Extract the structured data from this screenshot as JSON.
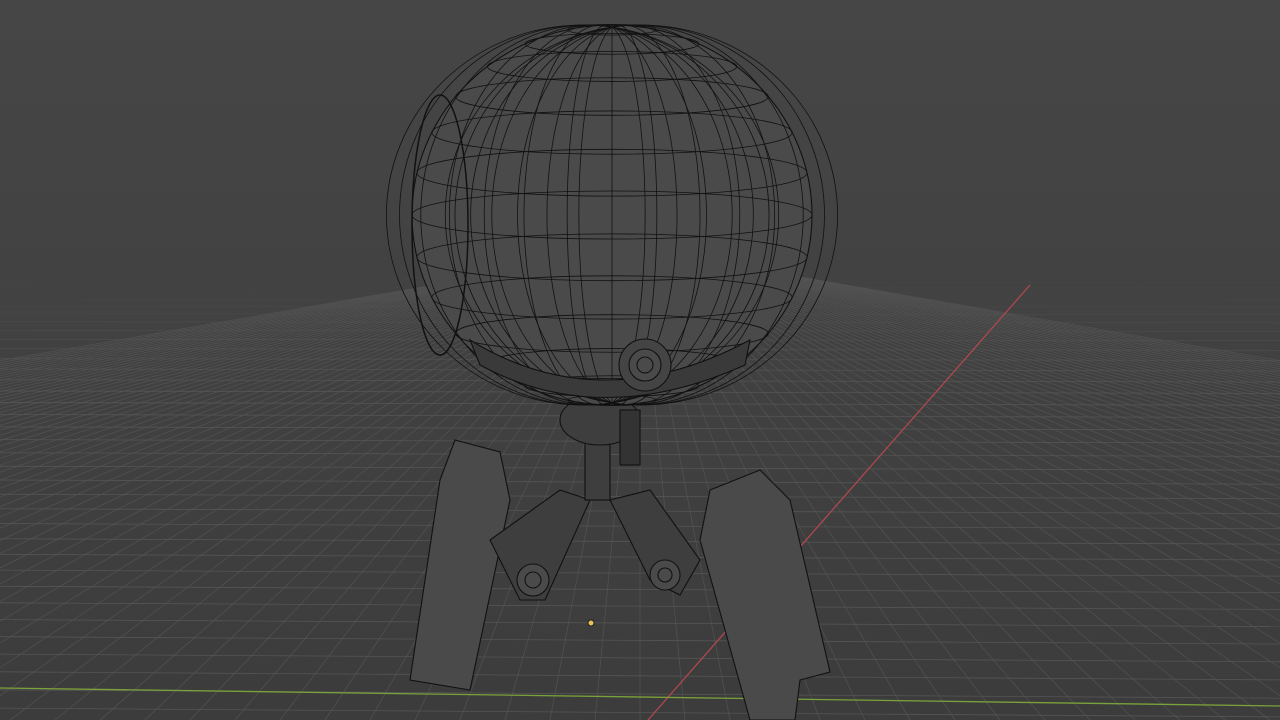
{
  "viewport": {
    "mode": "wireframe",
    "colors": {
      "background": "#444444",
      "grid": "#555555",
      "x_axis": "#b0484f",
      "y_axis": "#7aa23a",
      "wire": "#111111",
      "origin": "#e8c15a"
    },
    "object": "robot"
  }
}
